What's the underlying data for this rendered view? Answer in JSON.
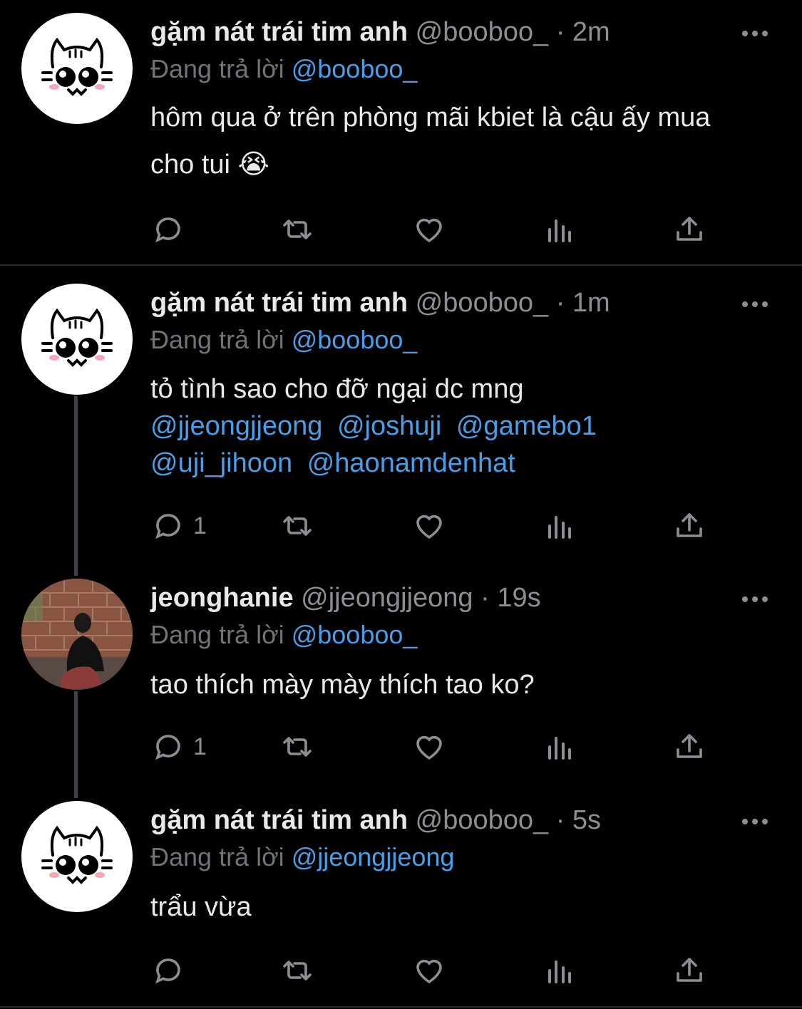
{
  "tweets": [
    {
      "name": "gặm nát trái tim anh",
      "handle": "@booboo_",
      "sep": "·",
      "time": "2m",
      "replying_label": "Đang trả lời",
      "replying_to": "@booboo_",
      "text": "hôm qua ở trên phòng mãi kbiet là cậu ấy mua cho tui 😭",
      "reply_count": "",
      "avatar": "cat-avatar-icon"
    },
    {
      "name": "gặm nát trái tim anh",
      "handle": "@booboo_",
      "sep": "·",
      "time": "1m",
      "replying_label": "Đang trả lời",
      "replying_to": "@booboo_",
      "text": "tỏ tình sao cho đỡ ngại dc mng",
      "mentions": [
        "@jjeongjjeong",
        "@joshuji",
        "@gamebo1",
        "@uji_jihoon",
        "@haonamdenhat"
      ],
      "reply_count": "1",
      "avatar": "cat-avatar-icon"
    },
    {
      "name": "jeonghanie",
      "handle": "@jjeongjjeong",
      "sep": "·",
      "time": "19s",
      "replying_label": "Đang trả lời",
      "replying_to": "@booboo_",
      "text": "tao thích mày mày thích tao ko?",
      "reply_count": "1",
      "avatar": "photo-avatar"
    },
    {
      "name": "gặm nát trái tim anh",
      "handle": "@booboo_",
      "sep": "·",
      "time": "5s",
      "replying_label": "Đang trả lời",
      "replying_to": "@jjeongjjeong",
      "text": "trẩu vừa",
      "reply_count": "",
      "avatar": "cat-avatar-icon"
    }
  ],
  "colors": {
    "background": "#000000",
    "link": "#4a9ee8",
    "muted": "#8b8f94"
  }
}
